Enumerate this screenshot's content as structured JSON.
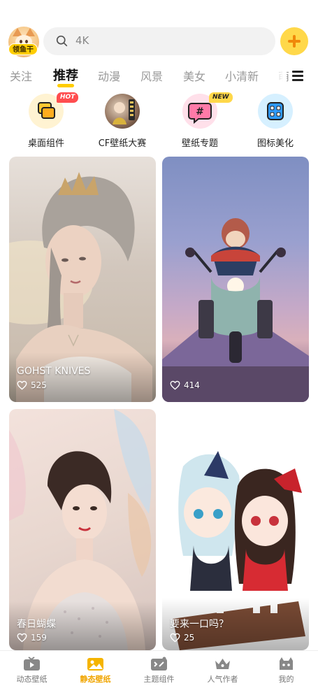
{
  "header": {
    "avatar_badge": "领鱼干",
    "search_placeholder": "4K",
    "icons": {
      "search": "search-icon",
      "add": "plus-icon"
    },
    "accent_color": "#ffcd00"
  },
  "tabs": [
    {
      "label": "关注",
      "active": false
    },
    {
      "label": "推荐",
      "active": true
    },
    {
      "label": "动漫",
      "active": false
    },
    {
      "label": "风景",
      "active": false
    },
    {
      "label": "美女",
      "active": false
    },
    {
      "label": "小清新",
      "active": false
    },
    {
      "label": "萌",
      "active": false
    }
  ],
  "categories": [
    {
      "label": "桌面组件",
      "badge": "HOT",
      "icon": "desktop-widget-icon"
    },
    {
      "label": "CF壁纸大赛",
      "badge": "",
      "icon": "cf-contest-icon"
    },
    {
      "label": "壁纸专题",
      "badge": "NEW",
      "icon": "hashtag-topic-icon"
    },
    {
      "label": "图标美化",
      "badge": "",
      "icon": "icon-beautify-icon"
    }
  ],
  "cards": [
    {
      "caption": "GOHST KNIVES",
      "likes": "525"
    },
    {
      "caption": "",
      "likes": "414"
    },
    {
      "caption": "春日蝴蝶",
      "likes": "159"
    },
    {
      "caption": "要来一口吗？",
      "likes": "25"
    }
  ],
  "bottom_nav": [
    {
      "label": "动态壁纸",
      "active": false,
      "icon": "dynamic-wallpaper-icon"
    },
    {
      "label": "静态壁纸",
      "active": true,
      "icon": "static-wallpaper-icon"
    },
    {
      "label": "主题组件",
      "active": false,
      "icon": "theme-widget-icon"
    },
    {
      "label": "人气作者",
      "active": false,
      "icon": "crown-icon"
    },
    {
      "label": "我的",
      "active": false,
      "icon": "profile-icon"
    }
  ]
}
